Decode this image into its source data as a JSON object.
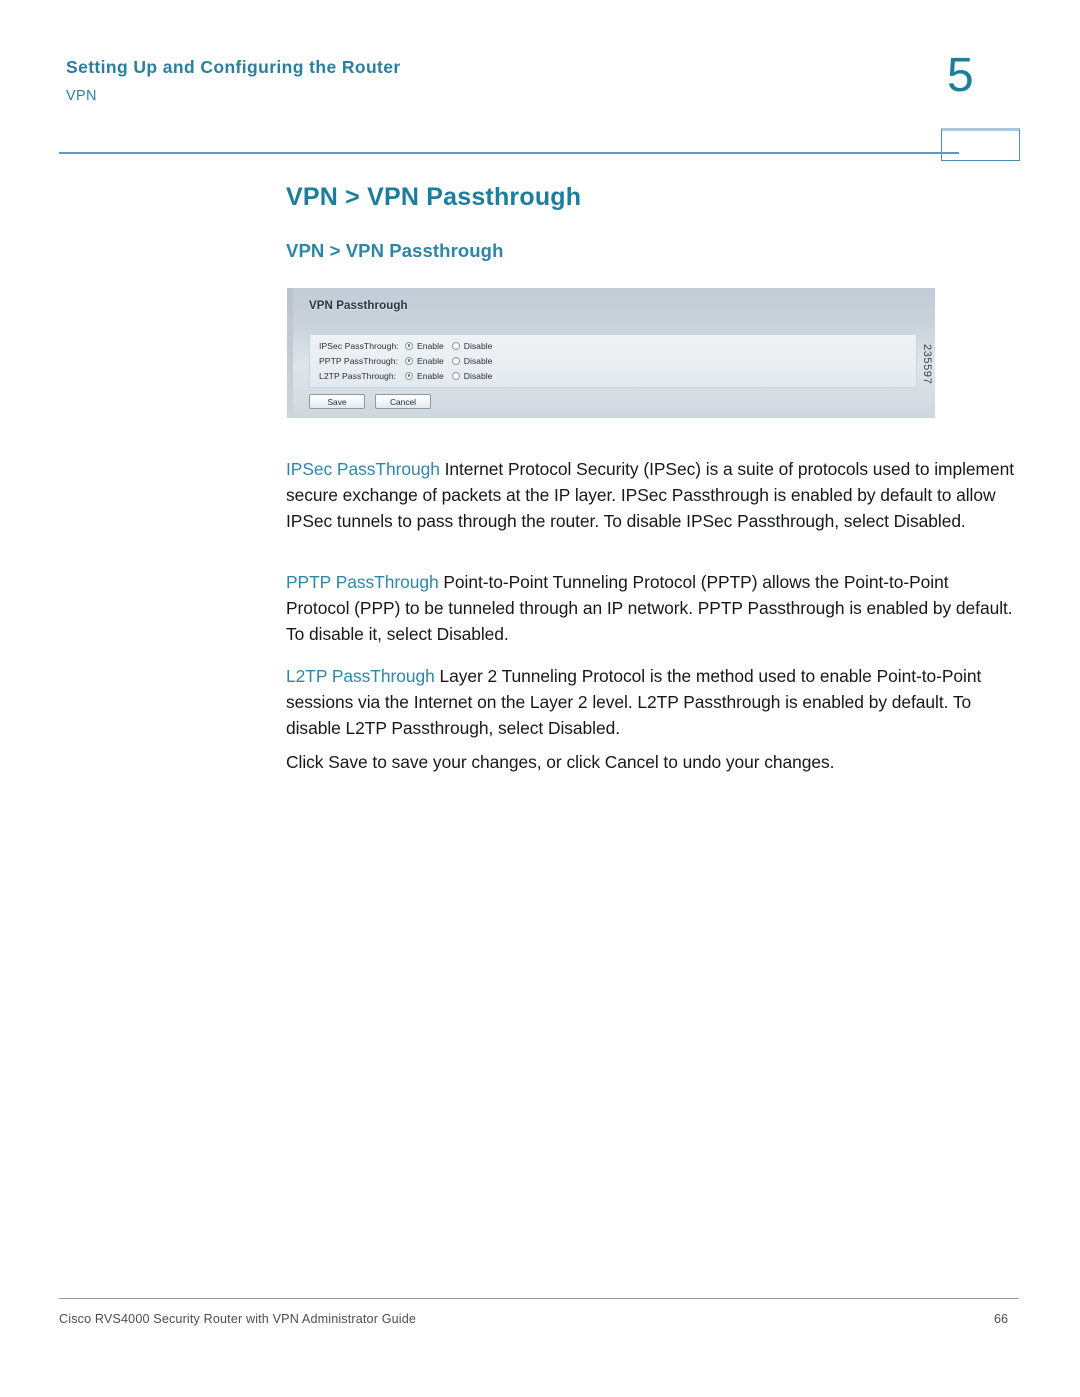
{
  "header": {
    "title": "Setting Up and Configuring the Router",
    "subtitle": "VPN",
    "chapter_number": "5"
  },
  "headings": {
    "h1": "VPN > VPN Passthrough",
    "h2": "VPN > VPN Passthrough"
  },
  "figure": {
    "number": "235597",
    "panel_title": "VPN Passthrough",
    "rows": [
      {
        "label": "IPSec PassThrough:",
        "options": [
          {
            "text": "Enable",
            "selected": true
          },
          {
            "text": "Disable",
            "selected": false
          }
        ]
      },
      {
        "label": "PPTP PassThrough:",
        "options": [
          {
            "text": "Enable",
            "selected": true
          },
          {
            "text": "Disable",
            "selected": false
          }
        ]
      },
      {
        "label": "L2TP PassThrough:",
        "options": [
          {
            "text": "Enable",
            "selected": true
          },
          {
            "text": "Disable",
            "selected": false
          }
        ]
      }
    ],
    "buttons": {
      "save": "Save",
      "cancel": "Cancel"
    }
  },
  "body": {
    "p1_term": "IPSec PassThrough",
    "p1_text": " Internet Protocol Security (IPSec) is a suite of protocols used to implement secure exchange of packets at the IP layer. IPSec Passthrough is enabled by default to allow IPSec tunnels to pass through the router. To disable IPSec Passthrough, select Disabled.",
    "p2_term": "PPTP PassThrough",
    "p2_text": " Point-to-Point Tunneling Protocol (PPTP) allows the Point-to-Point Protocol (PPP) to be tunneled through an IP network. PPTP Passthrough is enabled by default. To disable it, select Disabled.",
    "p3_term": "L2TP PassThrough",
    "p3_text": " Layer 2 Tunneling Protocol is the method used to enable Point-to-Point sessions via the Internet on the Layer 2 level. L2TP Passthrough is enabled by default. To disable L2TP Passthrough, select Disabled.",
    "p4_text": "Click Save to save your changes, or click Cancel to undo your changes."
  },
  "footer": {
    "document_title": "Cisco RVS4000 Security Router with VPN Administrator Guide",
    "page_number": "66"
  },
  "colors": {
    "heading_blue": "#1d7e9c",
    "subheading_blue": "#2c86a6",
    "runin_blue": "#2e87a8",
    "rule_blue": "#5b9bc9",
    "radio_selected_green": "#2f9e3f"
  }
}
